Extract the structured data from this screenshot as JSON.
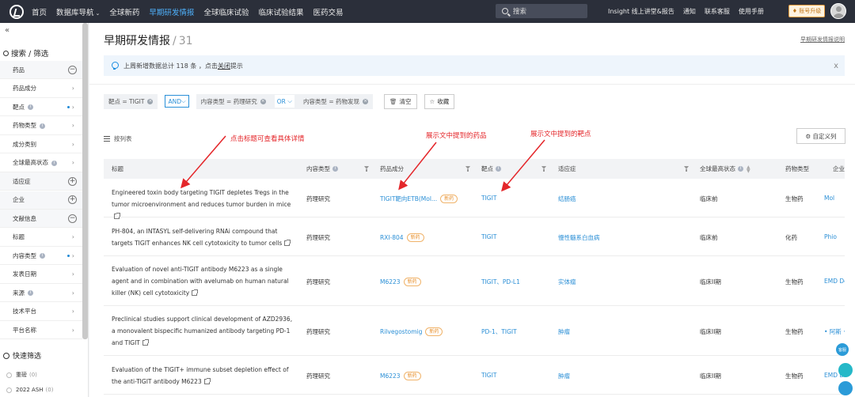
{
  "nav": {
    "items": [
      "首页",
      "数据库导航",
      "全球新药",
      "早期研发情报",
      "全球临床试验",
      "临床试验结果",
      "医药交易"
    ],
    "active_index": 3,
    "search_placeholder": "搜索",
    "right_links": [
      "Insight 线上讲堂&报告",
      "通知",
      "联系客服",
      "使用手册"
    ],
    "upgrade_label": "账号升级"
  },
  "sidebar": {
    "collapse": "«",
    "title": "搜索 / 筛选",
    "rows": [
      {
        "label": "药品",
        "kind": "group",
        "ctrl": "−"
      },
      {
        "label": "药品成分",
        "kind": "item",
        "ctrl": "›"
      },
      {
        "label": "靶点",
        "kind": "item",
        "ctrl": "›",
        "info": true,
        "dot": true
      },
      {
        "label": "药物类型",
        "kind": "item",
        "ctrl": "›",
        "info": true
      },
      {
        "label": "成分类别",
        "kind": "item",
        "ctrl": "›"
      },
      {
        "label": "全球最高状态",
        "kind": "item",
        "ctrl": "›",
        "info": true
      },
      {
        "label": "适应症",
        "kind": "group",
        "ctrl": "+"
      },
      {
        "label": "企业",
        "kind": "group",
        "ctrl": "+"
      },
      {
        "label": "文献信息",
        "kind": "group",
        "ctrl": "−"
      },
      {
        "label": "标题",
        "kind": "item",
        "ctrl": "›"
      },
      {
        "label": "内容类型",
        "kind": "item",
        "ctrl": "›",
        "info": true,
        "dot": true
      },
      {
        "label": "发表日期",
        "kind": "item",
        "ctrl": "›"
      },
      {
        "label": "来源",
        "kind": "item",
        "ctrl": "›",
        "info": true
      },
      {
        "label": "技术平台",
        "kind": "item",
        "ctrl": "›"
      },
      {
        "label": "平台名称",
        "kind": "item",
        "ctrl": "›"
      }
    ],
    "quick_title": "快速筛选",
    "quick_items": [
      {
        "label": "重磅",
        "count": "(0)"
      },
      {
        "label": "2022 ASH",
        "count": "(0)"
      }
    ]
  },
  "page": {
    "title": "早期研发情报",
    "count": "31",
    "help_link": "早期研发情报说明",
    "notice_pre": "上周新增数据总计 118 条 ，点击 ",
    "notice_link": "关闭",
    "notice_post": " 提示",
    "notice_close": "x"
  },
  "filters": {
    "chip1": "靶点 = TIGIT",
    "logic1": "AND",
    "chip2": "内容类型 = 药理研究",
    "logic2": "OR",
    "chip3": "内容类型 = 药物发现",
    "clear_label": "清空",
    "save_label": "收藏"
  },
  "list_label": "按列表",
  "custom_cols_label": "自定义列",
  "table": {
    "headers": [
      "标题",
      "内容类型",
      "药品成分",
      "靶点",
      "适应症",
      "全球最高状态",
      "药物类型",
      "企业"
    ],
    "rows": [
      {
        "title": "Engineered toxin body targeting TIGIT depletes Tregs in the tumor microenvironment and reduces tumor burden in mice",
        "type": "药理研究",
        "drug": "TIGIT靶向ETB(Mol...",
        "drug_tag": "新药",
        "target": "TIGIT",
        "indication": "结肠癌",
        "status": "临床前",
        "drug_type": "生物药",
        "company": "Mol"
      },
      {
        "title": "PH-804, an INTASYL self-delivering RNAi compound that targets TIGIT enhances NK cell cytotoxicity to tumor cells",
        "type": "药理研究",
        "drug": "RXI-804",
        "drug_tag": "新药",
        "target": "TIGIT",
        "indication": "慢性髓系白血病",
        "status": "临床前",
        "drug_type": "化药",
        "company": "Phio"
      },
      {
        "title": "Evaluation of novel anti-TIGIT antibody M6223 as a single agent and in combination with avelumab on human natural killer (NK) cell cytotoxicity",
        "type": "药理研究",
        "drug": "M6223",
        "drug_tag": "新药",
        "target": "TIGIT、PD-L1",
        "indication": "实体瘤",
        "status": "临床II期",
        "drug_type": "生物药",
        "company": "EMD Dev"
      },
      {
        "title": "Preclinical studies support clinical development of AZD2936, a monovalent bispecific humanized antibody targeting PD-1 and TIGIT",
        "type": "药理研究",
        "drug": "Rilvegostomig",
        "drug_tag": "新药",
        "target": "PD-1、TIGIT",
        "indication": "肿瘤",
        "status": "临床II期",
        "drug_type": "生物药",
        "company": "• 阿斯 • 信达 康"
      },
      {
        "title": "Evaluation of the TIGIT+ immune subset depletion effect of the anti-TIGIT antibody M6223",
        "type": "药理研究",
        "drug": "M6223",
        "drug_tag": "新药",
        "target": "TIGIT",
        "indication": "肿瘤",
        "status": "临床II期",
        "drug_type": "生物药",
        "company": "EMD Dev"
      }
    ]
  },
  "annotations": {
    "a1": "点击标题可查看具体详情",
    "a2": "展示文中提到的药品",
    "a3": "展示文中提到的靶点"
  },
  "float_label": "客服",
  "colors": {
    "nav_bg": "#2b2f3a",
    "accent": "#2b8fd6",
    "annotation": "#e4262a",
    "tag": "#e88f2b"
  }
}
